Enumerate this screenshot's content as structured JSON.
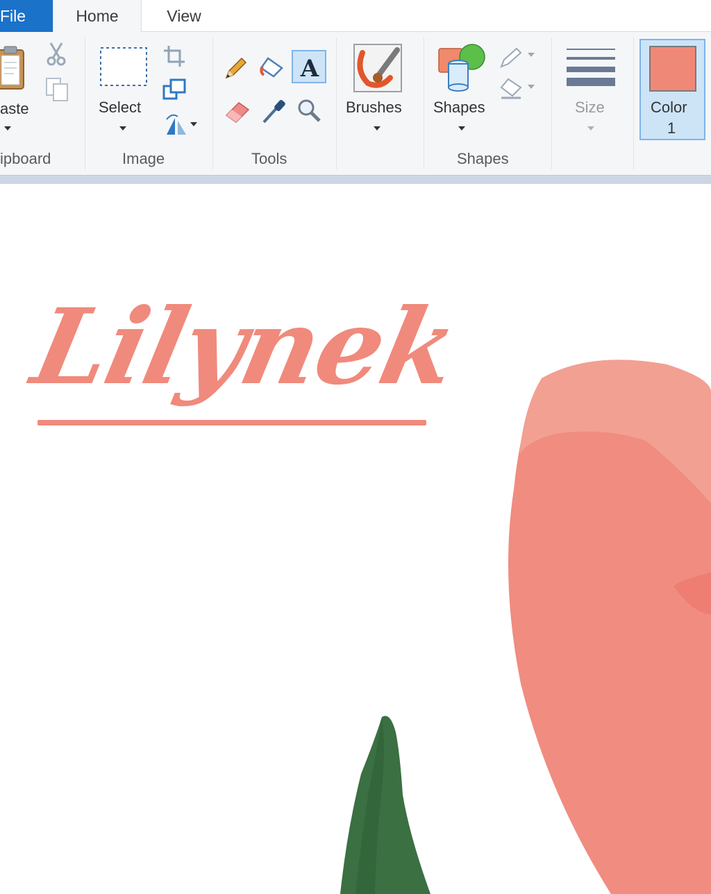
{
  "tabs": {
    "file": "File",
    "home": "Home",
    "view": "View"
  },
  "ribbon": {
    "clipboard": {
      "paste_label": "aste",
      "group_label": "ipboard"
    },
    "image": {
      "select_label": "Select",
      "group_label": "Image"
    },
    "tools": {
      "group_label": "Tools"
    },
    "brushes": {
      "label": "Brushes"
    },
    "shapes": {
      "label": "Shapes",
      "group_label": "Shapes"
    },
    "size": {
      "label": "Size"
    },
    "color1": {
      "line1": "Color",
      "line2": "1",
      "value": "#f08878"
    }
  },
  "canvas": {
    "logo_text": "Lilynek"
  },
  "colors": {
    "file_tab": "#1a72c9",
    "accent_pink": "#f08a7c",
    "leaf_green": "#3b7042",
    "selection_blue": "#cde4f7"
  }
}
